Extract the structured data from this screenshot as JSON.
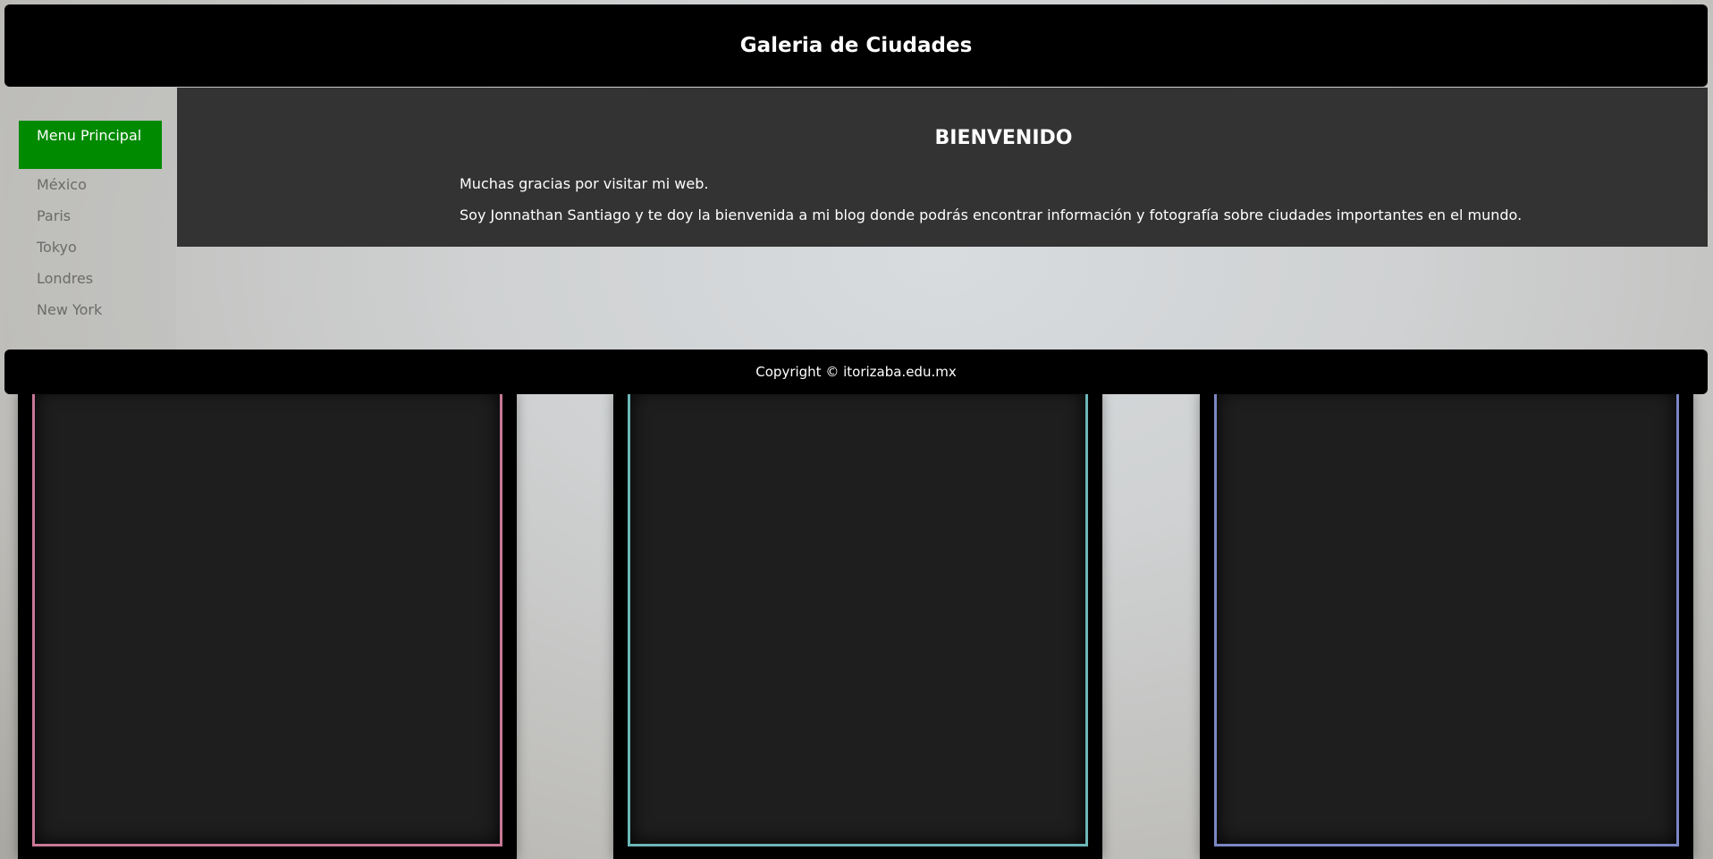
{
  "header": {
    "title": "Galeria de Ciudades"
  },
  "menu": {
    "items": [
      {
        "label": "Menu Principal",
        "active": true
      },
      {
        "label": "México",
        "active": false
      },
      {
        "label": "Paris",
        "active": false
      },
      {
        "label": "Tokyo",
        "active": false
      },
      {
        "label": "Londres",
        "active": false
      },
      {
        "label": "New York",
        "active": false
      }
    ]
  },
  "main": {
    "heading": "BIENVENIDO",
    "line1": "Muchas gracias por visitar mi web.",
    "line2": "Soy Jonnathan Santiago y te doy la bienvenida a mi blog donde podrás encontrar información y fotografía sobre ciudades importantes en el mundo."
  },
  "footer": {
    "text": "Copyright © itorizaba.edu.mx"
  },
  "colors": {
    "header_bg": "#000000",
    "active_menu": "#008a00",
    "main_bg": "#333333",
    "frame_pink": "#c87896",
    "frame_teal": "#6cb6b8",
    "frame_blue": "#7b87c4"
  }
}
